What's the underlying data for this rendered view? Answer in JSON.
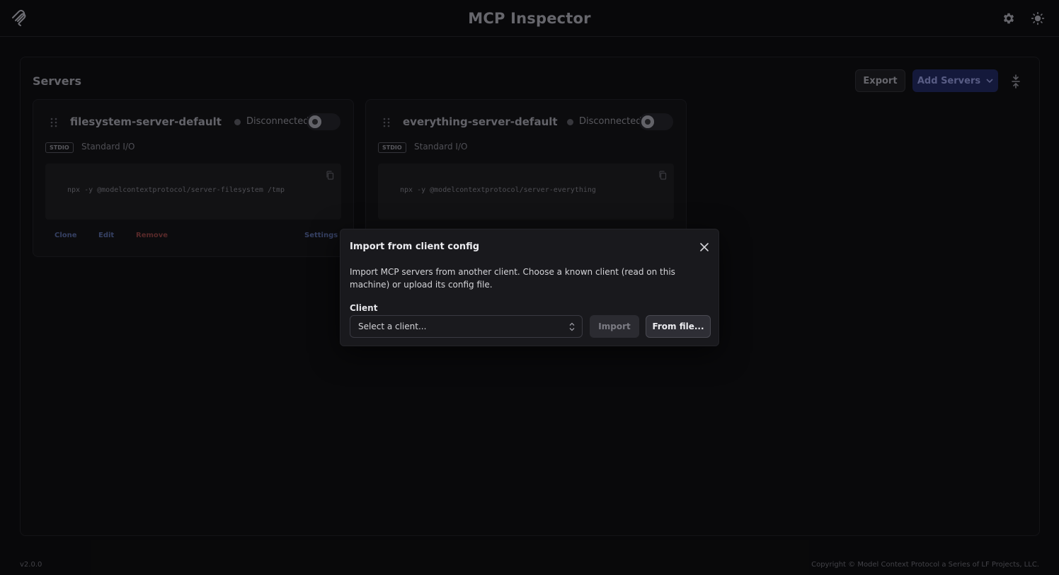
{
  "header": {
    "title": "MCP Inspector",
    "logo_icon": "mcp-logo-icon",
    "settings_icon": "gear-icon",
    "theme_icon": "sun-icon"
  },
  "servers_panel": {
    "title": "Servers",
    "export_label": "Export",
    "add_servers_label": "Add Servers",
    "collapse_icon": "collapse-icon"
  },
  "servers": [
    {
      "name": "filesystem-server-default",
      "status": "Disconnected",
      "transport_tag": "STDIO",
      "transport_desc": "Standard I/O",
      "command": "npx -y @modelcontextprotocol/server-filesystem /tmp",
      "actions": {
        "clone": "Clone",
        "edit": "Edit",
        "remove": "Remove",
        "settings": "Settings"
      }
    },
    {
      "name": "everything-server-default",
      "status": "Disconnected",
      "transport_tag": "STDIO",
      "transport_desc": "Standard I/O",
      "command": "npx -y @modelcontextprotocol/server-everything"
    }
  ],
  "footer": {
    "version": "v2.0.0",
    "copyright": "Copyright © Model Context Protocol a Series of LF Projects, LLC."
  },
  "dialog": {
    "title": "Import from client config",
    "description": "Import MCP servers from another client. Choose a known client (read on this machine) or upload its config file.",
    "client_label": "Client",
    "client_placeholder": "Select a client...",
    "import_label": "Import",
    "from_file_label": "From file..."
  },
  "colors": {
    "accent_button": "#1d2352",
    "remove_action": "#7a3a3a",
    "dialog_bg": "#19191d"
  }
}
